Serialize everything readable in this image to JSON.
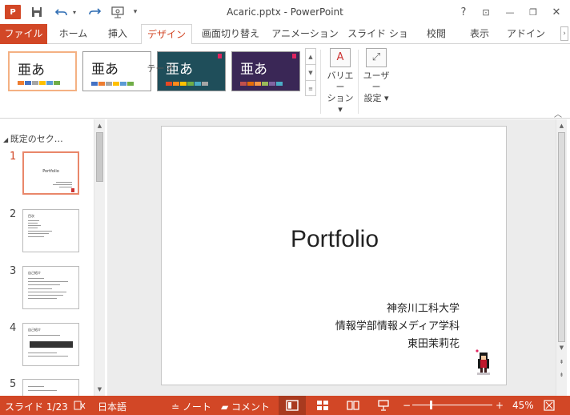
{
  "window": {
    "title": "Acaric.pptx - PowerPoint",
    "app_icon": "P",
    "help": "?",
    "restore_ribbon": "⊡",
    "minimize": "—",
    "restore": "❐",
    "close": "✕"
  },
  "qat": {
    "save_icon": "save-icon",
    "undo_icon": "undo-icon",
    "redo_icon": "redo-icon",
    "present_icon": "presenter-icon",
    "customize": "▾"
  },
  "tabs": {
    "file": "ファイル",
    "home": "ホーム",
    "insert": "挿入",
    "design": "デザイン",
    "transitions": "画面切り替え",
    "animations": "アニメーション",
    "slideshow": "スライド ショー",
    "review": "校閲",
    "view": "表示",
    "addins": "アドイン"
  },
  "ribbon": {
    "themes": [
      {
        "label": "亜あ",
        "bg": "#ffffff",
        "text": "#222222",
        "colors": [
          "#ed7d31",
          "#4472c4",
          "#a5a5a5",
          "#ffc000",
          "#5b9bd5",
          "#70ad47"
        ]
      },
      {
        "label": "亜あ",
        "bg": "#ffffff",
        "text": "#222222",
        "colors": [
          "#4472c4",
          "#ed7d31",
          "#a5a5a5",
          "#ffc000",
          "#5b9bd5",
          "#70ad47"
        ]
      },
      {
        "label": "亜あ",
        "bg": "#1f4e5a",
        "text": "#ffffff",
        "colors": [
          "#e64823",
          "#ff8a1a",
          "#ffc000",
          "#70ad47",
          "#4bacc6",
          "#a5a5a5"
        ]
      },
      {
        "label": "亜あ",
        "bg": "#3a2756",
        "text": "#ffffff",
        "colors": [
          "#c0504d",
          "#e36c09",
          "#f79646",
          "#9bbb59",
          "#8064a2",
          "#4bacc6"
        ]
      }
    ],
    "group_label": "テーマ",
    "variation_label_1": "バリエー",
    "variation_label_2": "ション ▾",
    "custom_label_1": "ユーザー",
    "custom_label_2": "設定 ▾"
  },
  "thumbnails": {
    "section": "既定のセク…",
    "items": [
      {
        "num": "1",
        "active": true,
        "title": "Portfolio"
      },
      {
        "num": "2",
        "active": false,
        "title": "目次"
      },
      {
        "num": "3",
        "active": false,
        "title": "自己紹介"
      },
      {
        "num": "4",
        "active": false,
        "title": "自己紹介"
      },
      {
        "num": "5",
        "active": false,
        "title": ""
      }
    ]
  },
  "slide": {
    "title": "Portfolio",
    "subtitle_lines": [
      "神奈川工科大学",
      "情報学部情報メディア学科",
      "東田茉莉花"
    ]
  },
  "status": {
    "slide_info": "スライド 1/23",
    "spell_icon": "proofing-icon",
    "language": "日本語",
    "notes": "ノート",
    "comments": "コメント",
    "zoom_minus": "−",
    "zoom_plus": "+",
    "zoom": "45%",
    "zoom_level": 0.45
  },
  "colors": {
    "accent": "#d24726",
    "selected_theme_border": "#f4b183"
  }
}
